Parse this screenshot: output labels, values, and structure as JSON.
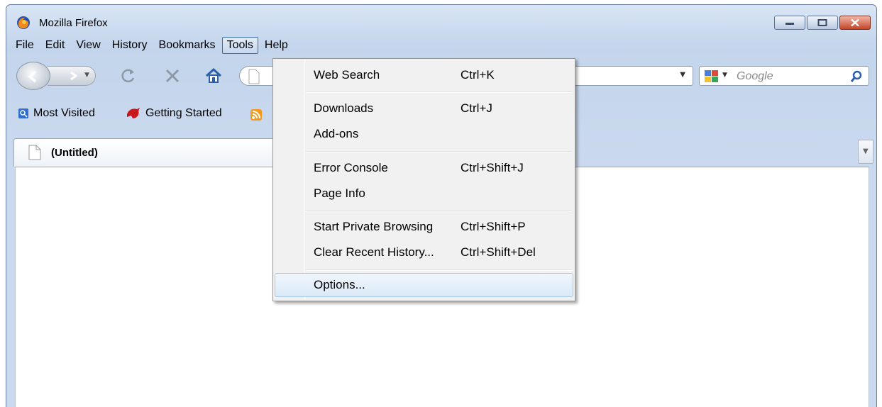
{
  "window": {
    "title": "Mozilla Firefox"
  },
  "menubar": {
    "items": [
      "File",
      "Edit",
      "View",
      "History",
      "Bookmarks",
      "Tools",
      "Help"
    ],
    "active": "Tools"
  },
  "search": {
    "placeholder": "Google"
  },
  "bookmarks": {
    "items": [
      "Most Visited",
      "Getting Started"
    ]
  },
  "tab": {
    "label": "(Untitled)"
  },
  "tools_menu": {
    "items": [
      {
        "label": "Web Search",
        "shortcut": "Ctrl+K"
      },
      {
        "label": "Downloads",
        "shortcut": "Ctrl+J"
      },
      {
        "label": "Add-ons",
        "shortcut": ""
      },
      {
        "label": "Error Console",
        "shortcut": "Ctrl+Shift+J"
      },
      {
        "label": "Page Info",
        "shortcut": ""
      },
      {
        "label": "Start Private Browsing",
        "shortcut": "Ctrl+Shift+P"
      },
      {
        "label": "Clear Recent History...",
        "shortcut": "Ctrl+Shift+Del"
      },
      {
        "label": "Options...",
        "shortcut": ""
      }
    ],
    "highlighted": "Options..."
  },
  "icons": {
    "app": "firefox-logo-icon",
    "back": "back-arrow-icon",
    "forward": "forward-arrow-icon",
    "reload": "reload-icon",
    "stop": "stop-icon",
    "home": "home-icon",
    "search_engine": "google-icon",
    "search_go": "magnifier-icon",
    "most_visited": "most-visited-icon",
    "getting_started": "getting-started-icon",
    "rss": "rss-icon",
    "page": "page-icon"
  },
  "colors": {
    "chrome": "#c3d5ec",
    "menu_bg": "#f1f1f1",
    "highlight": "#dbe9f7",
    "close_button": "#c3452a"
  }
}
